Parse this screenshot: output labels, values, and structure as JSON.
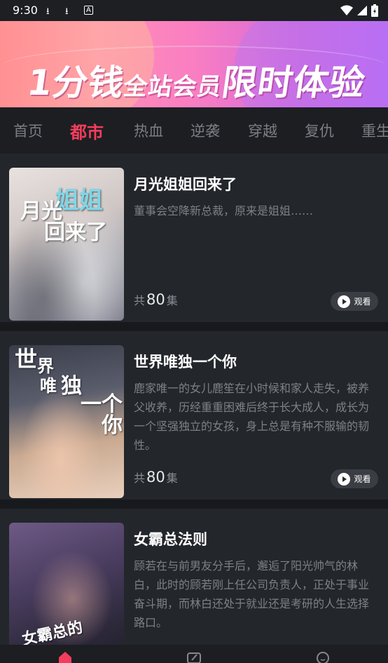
{
  "status": {
    "time": "9:30"
  },
  "banner": {
    "text_a": "1分钱",
    "text_b": "全站会员",
    "text_c": "限时体验"
  },
  "tabs": [
    "首页",
    "都市",
    "热血",
    "逆袭",
    "穿越",
    "复仇",
    "重生"
  ],
  "active_tab": "都市",
  "dramas": [
    {
      "title": "月光姐姐回来了",
      "desc": "董事会空降新总裁，原来是姐姐……",
      "count_prefix": "共",
      "count": "80",
      "count_suffix": "集",
      "watch_label": "观看",
      "cover_title": "月光姐姐回来了"
    },
    {
      "title": "世界唯独一个你",
      "desc": "鹿家唯一的女儿鹿笙在小时候和家人走失，被养父收养，历经重重困难后终于长大成人，成长为一个坚强独立的女孩，身上总是有种不服输的韧性。",
      "count_prefix": "共",
      "count": "80",
      "count_suffix": "集",
      "watch_label": "观看",
      "cover_title": "世界唯独一个你"
    },
    {
      "title": "女霸总法则",
      "desc": "顾若在与前男友分手后，邂逅了阳光帅气的林白，此时的顾若刚上任公司负责人，正处于事业奋斗期，而林白还处于就业还是考研的人生选择路口。",
      "cover_title": "女霸总的"
    }
  ],
  "colors": {
    "accent": "#f23d5c",
    "background": "#1a1c20",
    "card": "#23262b"
  }
}
